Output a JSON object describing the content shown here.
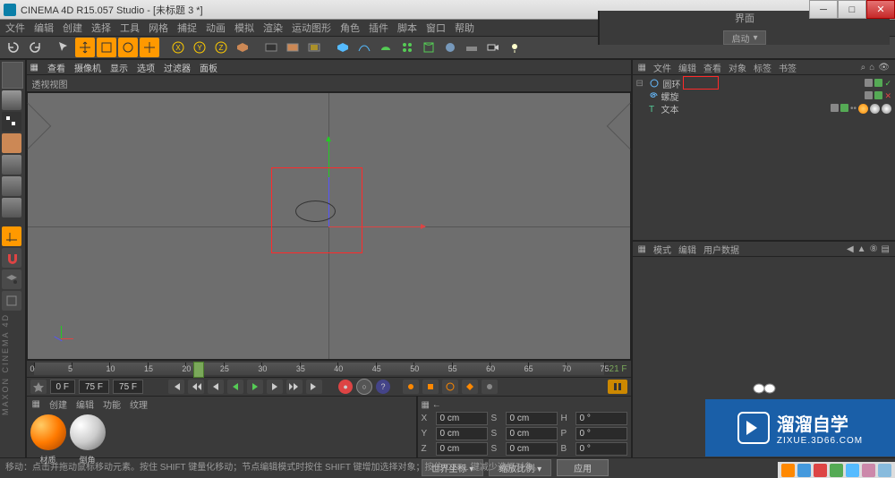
{
  "title": "CINEMA 4D R15.057 Studio - [未标题 3 *]",
  "menu": {
    "items": [
      "文件",
      "编辑",
      "创建",
      "选择",
      "工具",
      "网格",
      "捕捉",
      "动画",
      "模拟",
      "渲染",
      "运动图形",
      "角色",
      "插件",
      "脚本",
      "窗口",
      "帮助"
    ],
    "right_label": "界面",
    "layout": "启动"
  },
  "viewport": {
    "header": [
      "查看",
      "摄像机",
      "显示",
      "选项",
      "过滤器",
      "面板"
    ],
    "title": "透视视图"
  },
  "timeline": {
    "ticks": [
      0,
      5,
      10,
      15,
      20,
      25,
      30,
      35,
      40,
      45,
      50,
      55,
      60,
      65,
      70,
      75
    ],
    "current": 21,
    "end_label": "21 F"
  },
  "playbar": {
    "start": "0 F",
    "end": "75 F",
    "frame": "75 F"
  },
  "materials": {
    "tabs": [
      "创建",
      "编辑",
      "功能",
      "纹理"
    ],
    "items": [
      {
        "name": "材质"
      },
      {
        "name": "倒角"
      }
    ]
  },
  "coords": {
    "rows": [
      {
        "axis": "X",
        "pos": "0 cm",
        "size": "0 cm",
        "rot": "0 °",
        "rotlbl": "H"
      },
      {
        "axis": "Y",
        "pos": "0 cm",
        "size": "0 cm",
        "rot": "0 °",
        "rotlbl": "P"
      },
      {
        "axis": "Z",
        "pos": "0 cm",
        "size": "0 cm",
        "rot": "0 °",
        "rotlbl": "B"
      }
    ],
    "dd1": "世界坐标",
    "dd2": "缩放比例",
    "apply": "应用"
  },
  "obj_tabs": [
    "文件",
    "编辑",
    "查看",
    "对象",
    "标签",
    "书签"
  ],
  "objects": [
    {
      "name": "圆环",
      "icon": "circle",
      "color": "#6bf"
    },
    {
      "name": "螺旋",
      "icon": "spiral",
      "color": "#6bf"
    },
    {
      "name": "文本",
      "icon": "text",
      "color": "#5c9"
    }
  ],
  "attr_tabs": [
    "模式",
    "编辑",
    "用户数据"
  ],
  "status": "移动：点击并拖动鼠标移动元素。按住 SHIFT 键量化移动；节点编辑模式时按住 SHIFT 键增加选择对象；按住 CTRL 键减少选择对象。",
  "brand": {
    "big": "溜溜自学",
    "small": "ZIXUE.3D66.COM"
  }
}
